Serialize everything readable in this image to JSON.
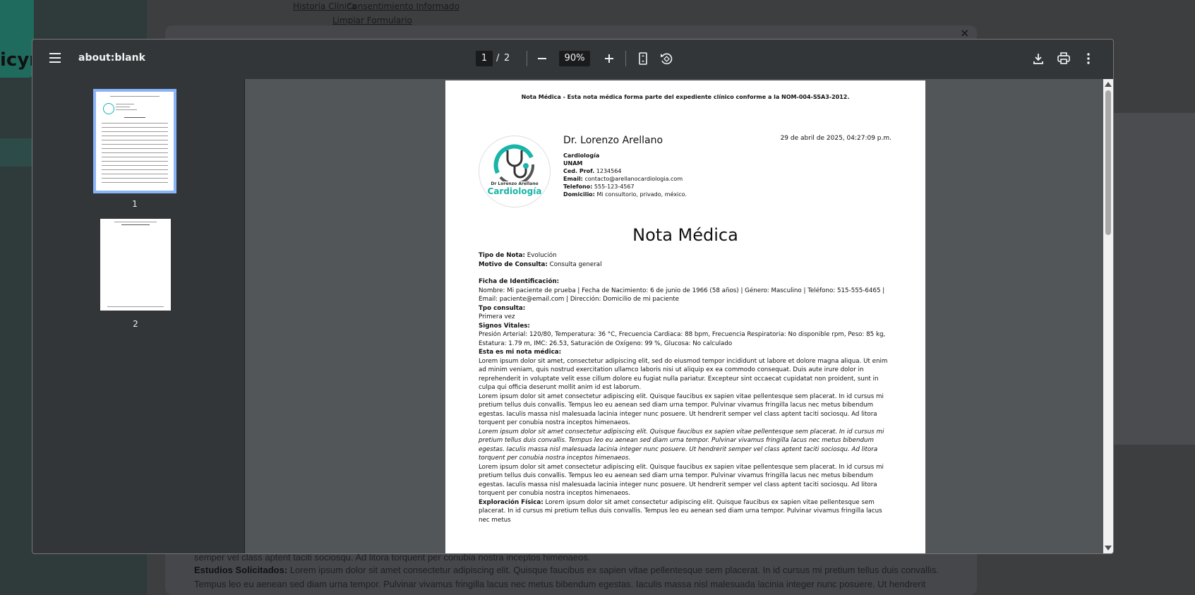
{
  "background": {
    "brand_fragment": "icyn",
    "links": [
      "Historia Clínica",
      "Consentimiento Informado",
      "Limpiar Formulario"
    ],
    "close_symbol": "×",
    "lines": [
      {
        "label": "",
        "text": "semper vel class aptent taciti sociosqu. Ad litora torquent per conubia nostra inceptos himenaeos."
      },
      {
        "label": "Estudios Solicitados:",
        "text": "Lorem ipsum dolor sit amet consectetur adipiscing elit. Quisque faucibus ex sapien vitae pellentesque sem placerat. In id cursus mi pretium tellus duis convallis."
      },
      {
        "label": "",
        "text": "Tempus leo eu aenean sed diam urna tempor. Pulvinar vivamus fringilla lacus nec metus bibendum egestas. Iaculis massa nisl malesuada lacinia integer nunc posuere. Ut hendrerit"
      }
    ]
  },
  "viewer": {
    "title": "about:blank",
    "current_page": "1",
    "page_sep": "/",
    "total_pages": "2",
    "zoom": "90%",
    "icons": [
      "menu-icon",
      "zoom-out-icon",
      "zoom-in-icon",
      "fit-page-icon",
      "rotate-icon",
      "download-icon",
      "print-icon",
      "more-icon"
    ],
    "thumbnails": [
      {
        "label": "1",
        "selected": true
      },
      {
        "label": "2",
        "selected": false
      }
    ],
    "accent": "#8ab4f8"
  },
  "document": {
    "header": "Nota Médica - Esta nota médica forma parte del expediente clínico conforme a la NOM-004-SSA3-2012.",
    "logo": {
      "sub": "Dr Lorenzo Arellano",
      "main": "Cardiología",
      "color": "#18b5a8"
    },
    "doctor": "Dr. Lorenzo Arellano",
    "date": "29 de abril de 2025, 04:27:09 p.m.",
    "specialty": "Cardiología",
    "university": "UNAM",
    "ced_label": "Ced. Prof.",
    "ced_value": "1234564",
    "email_label": "Email:",
    "email_value": "contacto@arellanocardiologia.com",
    "tel_label": "Telefono:",
    "tel_value": "555-123-4567",
    "dom_label": "Domicilio:",
    "dom_value": "Mi consultorio, privado, méxico.",
    "title": "Nota Médica",
    "tipo_label": "Tipo de Nota:",
    "tipo_value": "Evolución",
    "motivo_label": "Motivo de Consulta:",
    "motivo_value": "Consulta general",
    "ficha_label": "Ficha de Identificación:",
    "ficha_value": "Nombre: Mi paciente de prueba | Fecha de Nacimiento: 6 de junio de 1966 (58 años) | Género: Masculino | Teléfono: 515-555-6465 | Email: paciente@email.com | Dirección: Domicilio de mi paciente",
    "tpo_label": "Tpo consulta:",
    "tpo_value": "Primera vez",
    "signos_label": "Signos Vitales:",
    "signos_value": "Presión Arterial: 120/80, Temperatura: 36 °C, Frecuencia Cardiaca: 88 bpm, Frecuencia Respiratoria: No disponible rpm, Peso: 85 kg, Estatura: 1.79 m, IMC: 26.53, Saturación de Oxígeno: 99 %, Glucosa: No calculado",
    "nota_label": "Esta es mi nota médica:",
    "para1": "Lorem ipsum dolor sit amet, consectetur adipiscing elit, sed do eiusmod tempor incididunt ut labore et dolore magna aliqua. Ut enim ad minim veniam, quis nostrud exercitation ullamco laboris nisi ut aliquip ex ea commodo consequat. Duis aute irure dolor in reprehenderit in voluptate velit esse cillum dolore eu fugiat nulla pariatur. Excepteur sint occaecat cupidatat non proident, sunt in culpa qui officia deserunt mollit anim id est laborum.",
    "para2": "Lorem ipsum dolor sit amet consectetur adipiscing elit. Quisque faucibus ex sapien vitae pellentesque sem placerat. In id cursus mi pretium tellus duis convallis. Tempus leo eu aenean sed diam urna tempor. Pulvinar vivamus fringilla lacus nec metus bibendum egestas. Iaculis massa nisl malesuada lacinia integer nunc posuere. Ut hendrerit semper vel class aptent taciti sociosqu. Ad litora torquent per conubia nostra inceptos himenaeos.",
    "para3": "Lorem ipsum dolor sit amet consectetur adipiscing elit. Quisque faucibus ex sapien vitae pellentesque sem placerat. In id cursus mi pretium tellus duis convallis. Tempus leo eu aenean sed diam urna tempor. Pulvinar vivamus fringilla lacus nec metus bibendum egestas. Iaculis massa nisl malesuada lacinia integer nunc posuere. Ut hendrerit semper vel class aptent taciti sociosqu. Ad litora torquent per conubia nostra inceptos himenaeos.",
    "para4": "Lorem ipsum dolor sit amet consectetur adipiscing elit. Quisque faucibus ex sapien vitae pellentesque sem placerat. In id cursus mi pretium tellus duis convallis. Tempus leo eu aenean sed diam urna tempor. Pulvinar vivamus fringilla lacus nec metus bibendum egestas. Iaculis massa nisl malesuada lacinia integer nunc posuere. Ut hendrerit semper vel class aptent taciti sociosqu. Ad litora torquent per conubia nostra inceptos himenaeos.",
    "exploracion_label": "Exploración Física:",
    "exploracion_value": "Lorem ipsum dolor sit amet consectetur adipiscing elit. Quisque faucibus ex sapien vitae pellentesque sem placerat. In id cursus mi pretium tellus duis convallis. Tempus leo eu aenean sed diam urna tempor. Pulvinar vivamus fringilla lacus nec metus"
  }
}
